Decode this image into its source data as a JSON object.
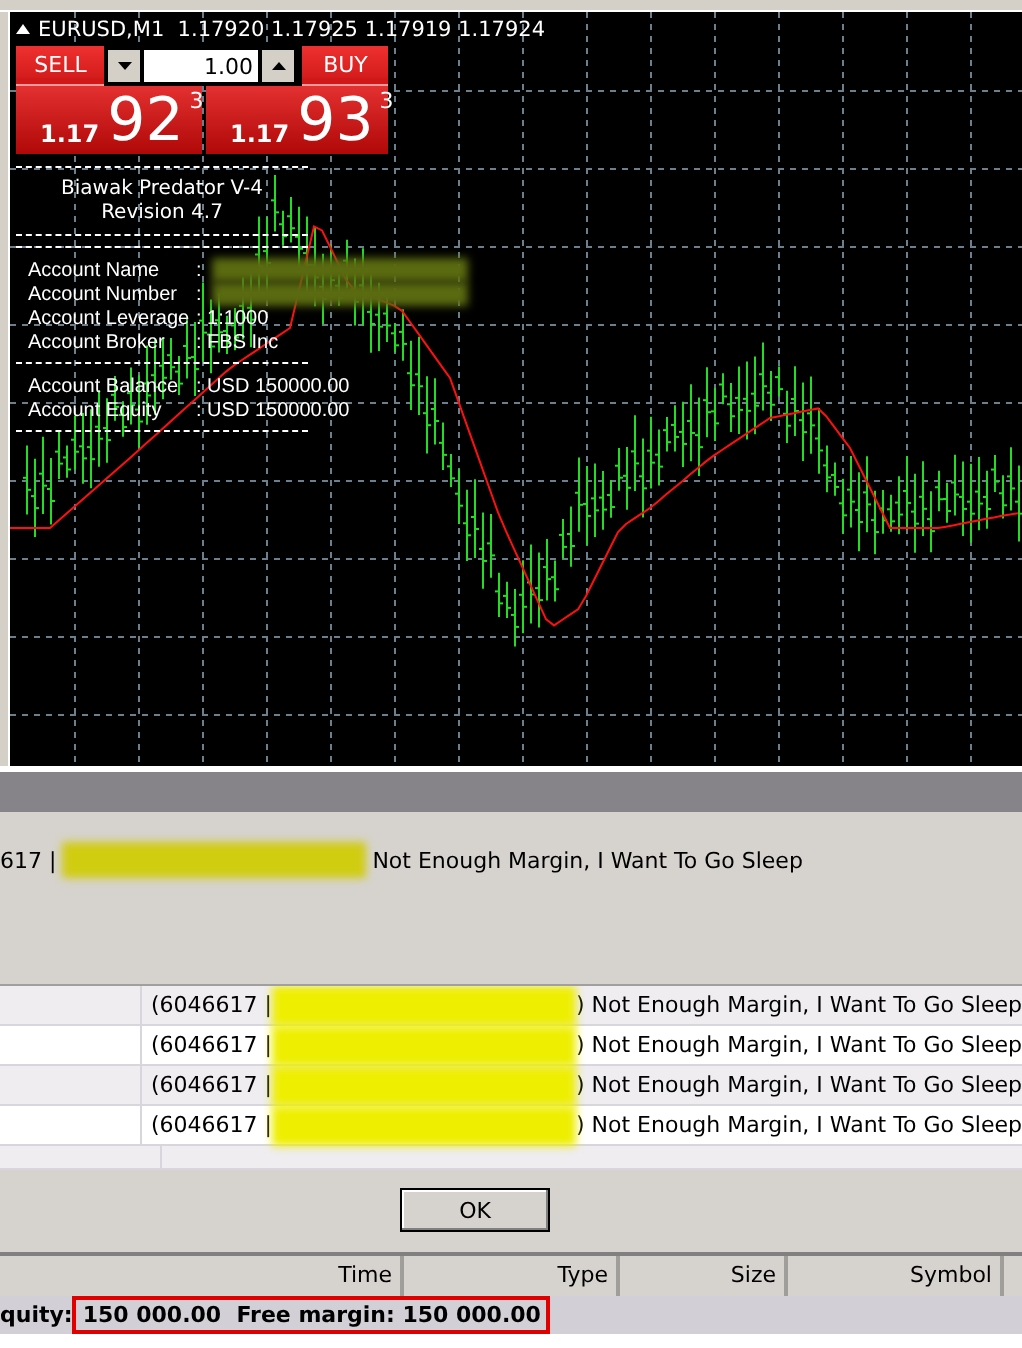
{
  "chart": {
    "symbol": "EURUSD,M1",
    "quotes": "1.17920 1.17925 1.17919 1.17924"
  },
  "trade_panel": {
    "sell_label": "SELL",
    "buy_label": "BUY",
    "lot": "1.00",
    "sell_price": {
      "big": "1.17",
      "pips": "92",
      "point": "3"
    },
    "buy_price": {
      "big": "1.17",
      "pips": "93",
      "point": "3"
    }
  },
  "info_panel": {
    "title": "Biawak Predator V-4",
    "revision": "Revision 4.7",
    "groups": [
      [
        {
          "label": "Account Name",
          "value": ":",
          "redacted": true
        },
        {
          "label": "Account Number",
          "value": ":",
          "redacted": true
        },
        {
          "label": "Account Leverage",
          "value": ": 1:1000",
          "redacted": false
        },
        {
          "label": "Account Broker",
          "value": ": FBS Inc",
          "redacted": false
        }
      ],
      [
        {
          "label": "Account Balance",
          "value": ": USD 150000.00",
          "redacted": false
        },
        {
          "label": "Account Equity",
          "value": ": USD 150000.00",
          "redacted": false
        }
      ]
    ]
  },
  "alert": {
    "prefix": "617 |",
    "message": "Not Enough Margin, I Want To Go Sleep"
  },
  "journal": {
    "rows": [
      {
        "prefix": "(6046617 |",
        "message": ") Not Enough Margin, I Want To Go Sleep"
      },
      {
        "prefix": "(6046617 |",
        "message": ") Not Enough Margin, I Want To Go Sleep"
      },
      {
        "prefix": "(6046617 |",
        "message": ") Not Enough Margin, I Want To Go Sleep"
      },
      {
        "prefix": "(6046617 |",
        "message": ") Not Enough Margin, I Want To Go Sleep"
      }
    ]
  },
  "ok_button": "OK",
  "columns": [
    "Time",
    "Type",
    "Size",
    "Symbol"
  ],
  "status": {
    "label": "quity:",
    "value": "150 000.00  Free margin: 150 000.00",
    "highlighted": true
  }
}
